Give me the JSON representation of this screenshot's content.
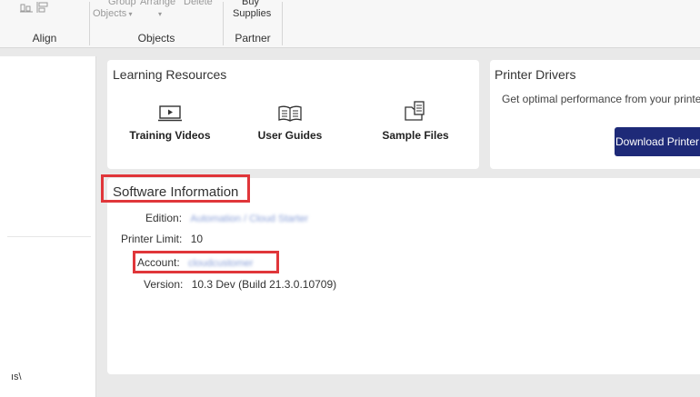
{
  "ribbon": {
    "align_label": "Align",
    "group_label": "Group",
    "arrange_label": "Arrange",
    "delete_label": "Delete",
    "objects_dropdown_label": "Objects",
    "objects_label": "Objects",
    "buy_label": "Buy",
    "supplies_label": "Supplies",
    "partner_label": "Partner"
  },
  "sidebar": {
    "path_text": "ıs\\"
  },
  "learning": {
    "title": "Learning Resources",
    "items": [
      {
        "label": "Training Videos",
        "icon": "video-icon"
      },
      {
        "label": "User Guides",
        "icon": "book-icon"
      },
      {
        "label": "Sample Files",
        "icon": "files-icon"
      }
    ]
  },
  "drivers": {
    "title": "Printer Drivers",
    "description": "Get optimal performance from your printe",
    "button_label": "Download Printer"
  },
  "software": {
    "title": "Software Information",
    "edition_label": "Edition:",
    "edition_value": "Automation / Cloud Starter",
    "printer_limit_label": "Printer Limit:",
    "printer_limit_value": "10",
    "account_label": "Account:",
    "account_value": "cloudcustomer",
    "version_label": "Version:",
    "version_value": "10.3 Dev (Build 21.3.0.10709)"
  },
  "colors": {
    "highlight": "#e0363a",
    "primary_button": "#1e2a78"
  }
}
